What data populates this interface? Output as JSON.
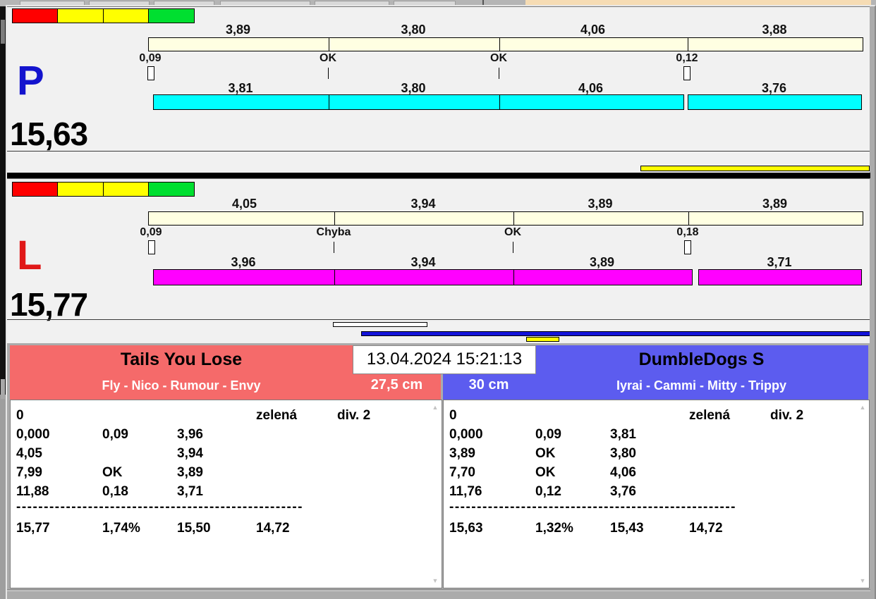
{
  "clock": "13.04.2024 15:21:13",
  "icons": {
    "scroll_up": "▲",
    "scroll_down": "▼"
  },
  "colors": {
    "panel_bg": "#F1F1F1",
    "cream_bar": "#FFFFE2",
    "p_bar": "#00FFFF",
    "l_bar": "#FF00FF",
    "p_letter": "#1414CE",
    "l_letter": "#E01818",
    "team_left_header": "#F56A6A",
    "team_right_header": "#5C5CEF",
    "progress_yellow": "#FFFF00",
    "progress_blue": "#1313D9",
    "status_blocks": [
      "#FF0000",
      "#FFFF00",
      "#FFFF00",
      "#00DF30"
    ]
  },
  "lanes": [
    {
      "label": "P",
      "total": "15,63",
      "top_segments": [
        "3,89",
        "3,80",
        "4,06",
        "3,88"
      ],
      "markers": [
        "0,09",
        "OK",
        "OK",
        "0,12"
      ],
      "bottom_segments": [
        "3,81",
        "3,80",
        "4,06",
        "3,76"
      ]
    },
    {
      "label": "L",
      "total": "15,77",
      "top_segments": [
        "4,05",
        "3,94",
        "3,89",
        "3,89"
      ],
      "markers": [
        "0,09",
        "Chyba",
        "OK",
        "0,18"
      ],
      "bottom_segments": [
        "3,96",
        "3,94",
        "3,89",
        "3,71"
      ]
    }
  ],
  "teams": [
    {
      "name": "Tails You Lose",
      "members": "Fly - Nico - Rumour - Envy",
      "height": "27,5 cm",
      "status": {
        "c1": "0",
        "c4": "zelená",
        "c5": "div. 2"
      },
      "rows": [
        {
          "c1": "0,000",
          "c2": "0,09",
          "c3": "3,96"
        },
        {
          "c1": "4,05",
          "c2": "",
          "c3": "3,94"
        },
        {
          "c1": "7,99",
          "c2": "OK",
          "c3": "3,89"
        },
        {
          "c1": "11,88",
          "c2": "0,18",
          "c3": "3,71"
        }
      ],
      "separator": "----------------------------------------------------",
      "totals": {
        "c1": "15,77",
        "c2": "1,74%",
        "c3": "15,50",
        "c4": "14,72"
      }
    },
    {
      "name": "DumbleDogs S",
      "members": "Iyrai - Cammi - Mitty - Trippy",
      "height": "30 cm",
      "status": {
        "c1": "0",
        "c4": "zelená",
        "c5": "div. 2"
      },
      "rows": [
        {
          "c1": "0,000",
          "c2": "0,09",
          "c3": "3,81"
        },
        {
          "c1": "3,89",
          "c2": "OK",
          "c3": "3,80"
        },
        {
          "c1": "7,70",
          "c2": "OK",
          "c3": "4,06"
        },
        {
          "c1": "11,76",
          "c2": "0,12",
          "c3": "3,76"
        }
      ],
      "separator": "----------------------------------------------------",
      "totals": {
        "c1": "15,63",
        "c2": "1,32%",
        "c3": "15,43",
        "c4": "14,72"
      }
    }
  ]
}
